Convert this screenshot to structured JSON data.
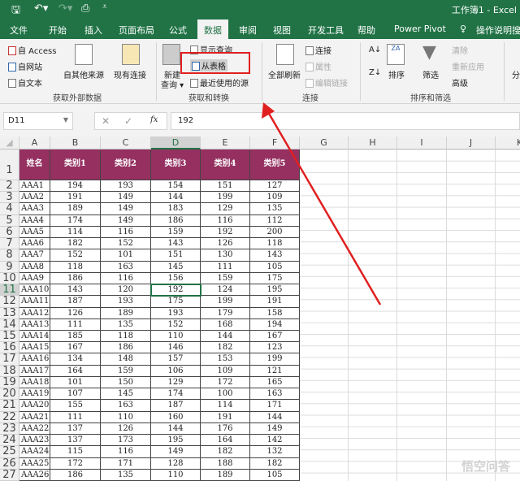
{
  "titlebar": {
    "title": "工作簿1  -  Excel"
  },
  "tabs": [
    "文件",
    "开始",
    "插入",
    "页面布局",
    "公式",
    "数据",
    "审阅",
    "视图",
    "开发工具",
    "帮助",
    "Power Pivot",
    "操作说明搜索"
  ],
  "ribbon": {
    "from_access": "自 Access",
    "from_web": "自网站",
    "from_text": "自文本",
    "from_other": "自其他来源",
    "existing": "现有连接",
    "new_query_1": "新建",
    "new_query_2": "查询 ▾",
    "show_queries": "显示查询",
    "from_table": "从表格",
    "recent_sources": "最近使用的源",
    "refresh_all": "全部刷新",
    "connections": "连接",
    "properties": "属性",
    "edit_links": "编辑链接",
    "sort": "排序",
    "filter": "筛选",
    "clear": "清除",
    "reapply": "重新应用",
    "advanced": "高级",
    "split": "分",
    "groups": [
      "获取外部数据",
      "获取和转换",
      "连接",
      "排序和筛选"
    ]
  },
  "formula_bar": {
    "name_box": "D11",
    "value": "192",
    "fx": "fx"
  },
  "columns": [
    "A",
    "B",
    "C",
    "D",
    "E",
    "F",
    "G",
    "H",
    "I",
    "J",
    "K"
  ],
  "headers": [
    "姓名",
    "类别1",
    "类别2",
    "类别3",
    "类别4",
    "类别5"
  ],
  "rows": [
    [
      "AAA1",
      194,
      193,
      154,
      151,
      127
    ],
    [
      "AAA2",
      191,
      149,
      144,
      199,
      109
    ],
    [
      "AAA3",
      189,
      149,
      183,
      129,
      135
    ],
    [
      "AAA4",
      174,
      149,
      186,
      116,
      112
    ],
    [
      "AAA5",
      114,
      116,
      159,
      192,
      200
    ],
    [
      "AAA6",
      182,
      152,
      143,
      126,
      118
    ],
    [
      "AAA7",
      152,
      101,
      151,
      130,
      143
    ],
    [
      "AAA8",
      118,
      163,
      145,
      111,
      105
    ],
    [
      "AAA9",
      186,
      116,
      156,
      159,
      175
    ],
    [
      "AAA10",
      143,
      120,
      192,
      124,
      195
    ],
    [
      "AAA11",
      187,
      193,
      175,
      199,
      191
    ],
    [
      "AAA12",
      126,
      189,
      193,
      179,
      158
    ],
    [
      "AAA13",
      111,
      135,
      152,
      168,
      194
    ],
    [
      "AAA14",
      185,
      118,
      110,
      144,
      167
    ],
    [
      "AAA15",
      167,
      186,
      146,
      182,
      123
    ],
    [
      "AAA16",
      134,
      148,
      157,
      153,
      199
    ],
    [
      "AAA17",
      164,
      159,
      106,
      109,
      121
    ],
    [
      "AAA18",
      101,
      150,
      129,
      172,
      165
    ],
    [
      "AAA19",
      107,
      145,
      174,
      100,
      163
    ],
    [
      "AAA20",
      155,
      163,
      187,
      114,
      171
    ],
    [
      "AAA21",
      111,
      110,
      160,
      191,
      144
    ],
    [
      "AAA22",
      137,
      126,
      144,
      176,
      149
    ],
    [
      "AAA23",
      137,
      173,
      195,
      164,
      142
    ],
    [
      "AAA24",
      115,
      116,
      149,
      182,
      132
    ],
    [
      "AAA25",
      172,
      171,
      128,
      188,
      182
    ],
    [
      "AAA26",
      186,
      135,
      110,
      189,
      105
    ]
  ],
  "watermark": "悟空问答",
  "colors": {
    "excel_green": "#217346",
    "header_fill": "#953061",
    "annotation": "#e02020"
  }
}
